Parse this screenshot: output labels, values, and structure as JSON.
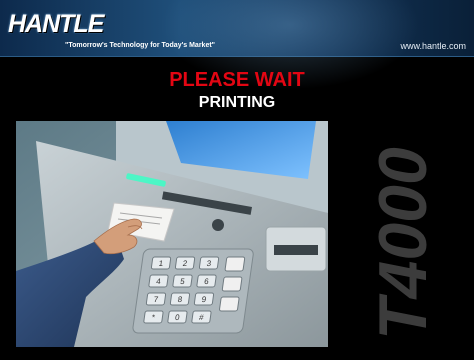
{
  "header": {
    "logo": "HANTLE",
    "tagline": "\"Tomorrow's Technology for Today's Market\"",
    "url": "www.hantle.com"
  },
  "status": {
    "title": "PLEASE WAIT",
    "subtitle": "PRINTING"
  },
  "machine": {
    "model": "T4000",
    "keypad_keys": [
      "1",
      "2",
      "3",
      "4",
      "5",
      "6",
      "7",
      "8",
      "9",
      "*",
      "0",
      "#"
    ]
  }
}
